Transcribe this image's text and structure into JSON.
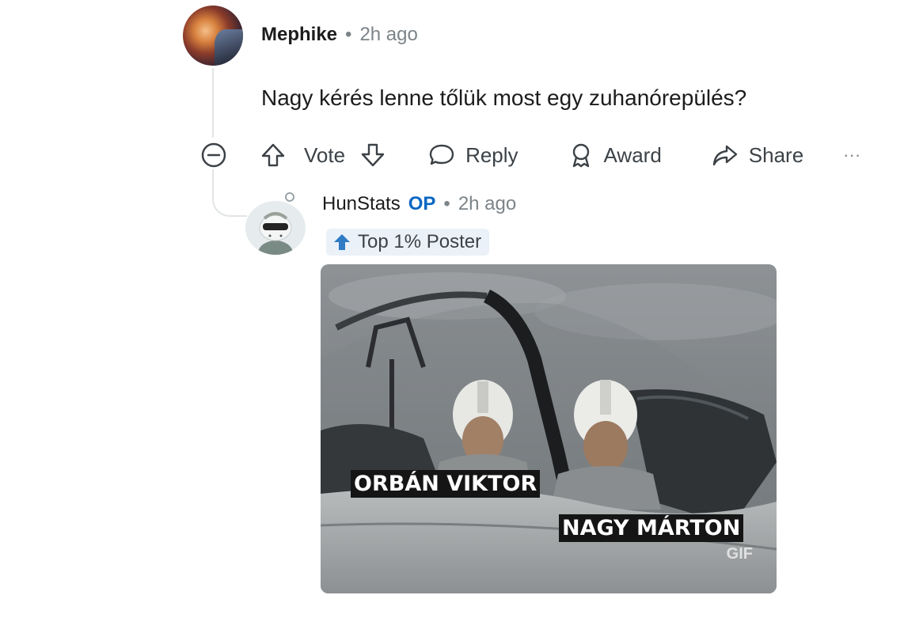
{
  "parent_comment": {
    "author": "Mephike",
    "separator": "•",
    "time": "2h ago",
    "text": "Nagy kérés lenne tőlük most egy zuhanórepülés?",
    "actions": {
      "upvote_icon": "arrow-up-icon",
      "vote_label": "Vote",
      "downvote_icon": "arrow-down-icon",
      "reply_label": "Reply",
      "award_label": "Award",
      "share_label": "Share",
      "more_label": "···"
    }
  },
  "reply_comment": {
    "author": "HunStats",
    "op_tag": "OP",
    "separator": "•",
    "time": "2h ago",
    "flair": "Top 1% Poster",
    "gif": {
      "caption_left": "ORBÁN VIKTOR",
      "caption_right": "NAGY MÁRTON",
      "label": "GIF"
    }
  },
  "colors": {
    "text": "#1c1c1c",
    "muted": "#7c8489",
    "op_blue": "#0a66c2",
    "flair_bg": "#eaf1f8"
  }
}
